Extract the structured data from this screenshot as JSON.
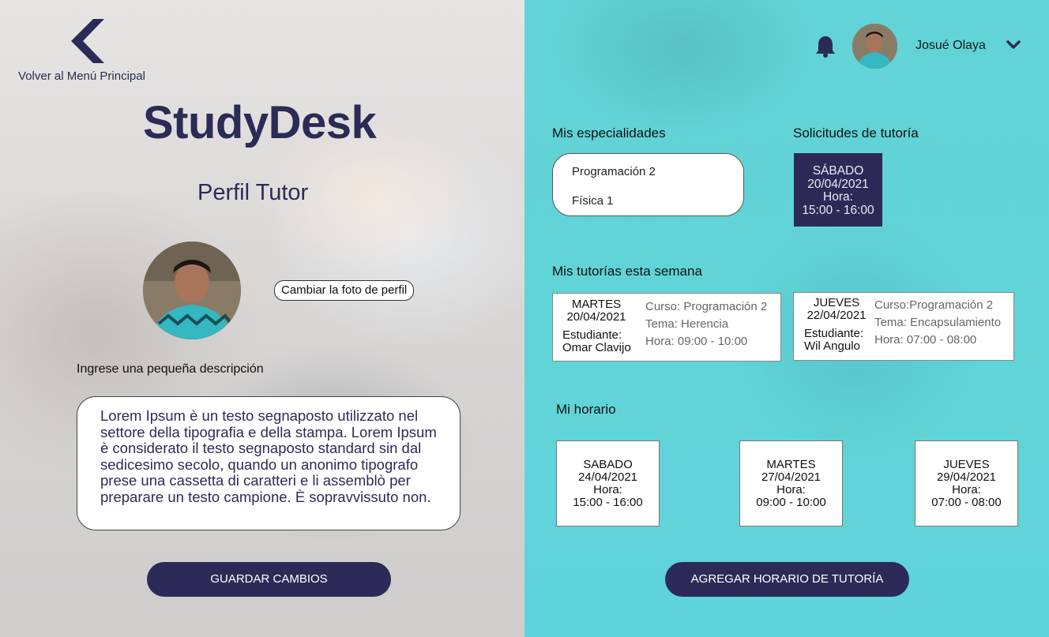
{
  "left": {
    "back_label": "Volver al Menú Principal",
    "brand": "StudyDesk",
    "profile_title": "Perfil Tutor",
    "change_photo_label": "Cambiar la foto de perfil",
    "description_label": "Ingrese una pequeña descripción",
    "description_value": "Lorem Ipsum è un testo segnaposto utilizzato nel settore della tipografia e della stampa. Lorem Ipsum è considerato il testo segnaposto standard sin dal sedicesimo secolo, quando un anonimo tipografo prese una cassetta di caratteri e li assemblò per preparare un testo campione. È sopravvissuto non.",
    "save_label": "GUARDAR CAMBIOS"
  },
  "header": {
    "user_name": "Josué Olaya"
  },
  "specialties": {
    "title": "Mis especialidades",
    "items": [
      "Programación 2",
      "Física 1"
    ]
  },
  "requests": {
    "title": "Solicitudes de tutoría",
    "items": [
      {
        "day": "SÁBADO",
        "date": "20/04/2021",
        "hour_label": "Hora:",
        "hour": "15:00 - 16:00"
      }
    ]
  },
  "week": {
    "title": "Mis tutorías esta semana",
    "items": [
      {
        "day": "MARTES",
        "date": "20/04/2021",
        "student_label": "Estudiante:",
        "student": "Omar Clavijo",
        "course": "Curso: Programación 2",
        "topic": "Tema: Herencia",
        "hour": "Hora: 09:00 - 10:00"
      },
      {
        "day": "JUEVES",
        "date": "22/04/2021",
        "student_label": "Estudiante:",
        "student": "Wil Angulo",
        "course": "Curso:Programación 2",
        "topic": "Tema: Encapsulamiento",
        "hour": "Hora: 07:00 - 08:00"
      }
    ]
  },
  "schedule": {
    "title": "Mi horario",
    "items": [
      {
        "day": "SABADO",
        "date": "24/04/2021",
        "hour_label": "Hora:",
        "hour": "15:00 - 16:00"
      },
      {
        "day": "MARTES",
        "date": "27/04/2021",
        "hour_label": "Hora:",
        "hour": "09:00 - 10:00"
      },
      {
        "day": "JUEVES",
        "date": "29/04/2021",
        "hour_label": "Hora:",
        "hour": "07:00 - 08:00"
      }
    ]
  },
  "add_schedule_label": "AGREGAR HORARIO DE TUTORÍA",
  "colors": {
    "navy": "#2c2b57",
    "teal": "#5fd4d8"
  }
}
